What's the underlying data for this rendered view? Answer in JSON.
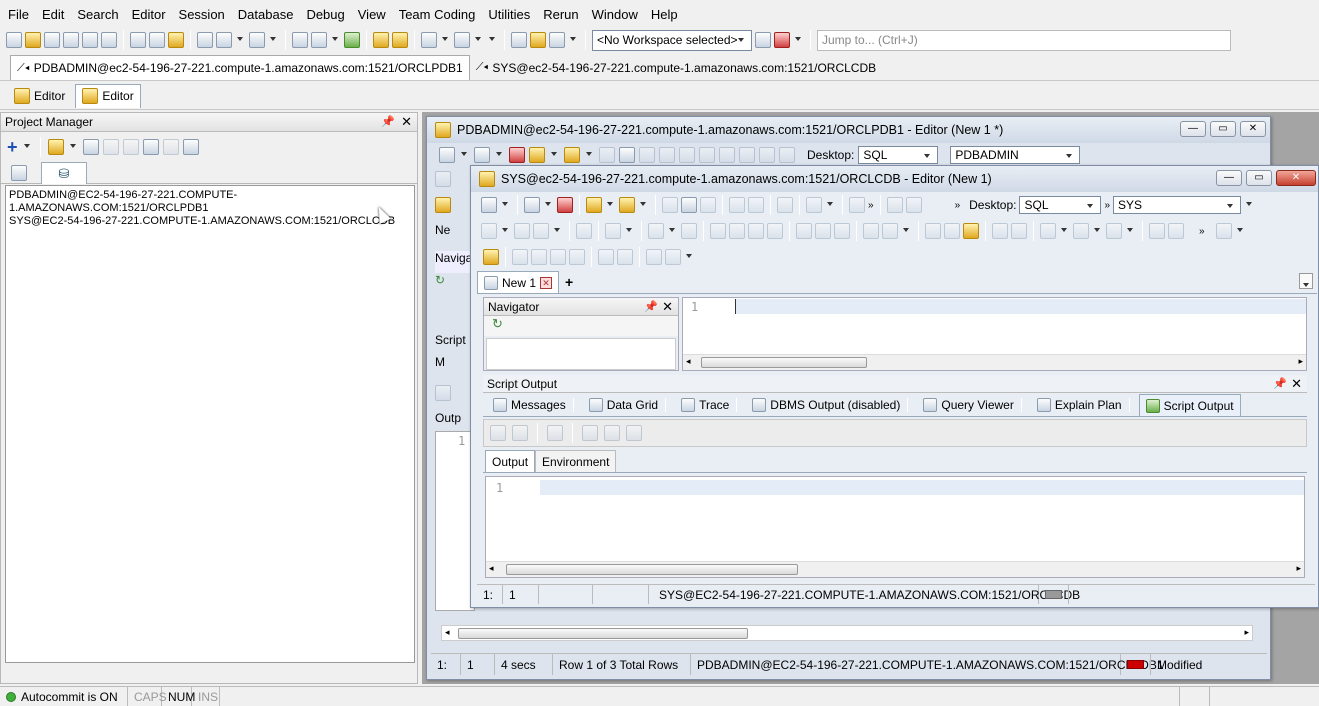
{
  "menu": [
    "File",
    "Edit",
    "Search",
    "Editor",
    "Session",
    "Database",
    "Debug",
    "View",
    "Team Coding",
    "Utilities",
    "Rerun",
    "Window",
    "Help"
  ],
  "workspace": {
    "selected": "<No Workspace selected>"
  },
  "jump": {
    "placeholder": "Jump to... (Ctrl+J)"
  },
  "connections": [
    {
      "label": "PDBADMIN@ec2-54-196-27-221.compute-1.amazonaws.com:1521/ORCLPDB1"
    },
    {
      "label": "SYS@ec2-54-196-27-221.compute-1.amazonaws.com:1521/ORCLCDB"
    }
  ],
  "editor_tabs": [
    "Editor",
    "Editor"
  ],
  "project_manager": {
    "title": "Project Manager",
    "items": [
      "PDBADMIN@EC2-54-196-27-221.COMPUTE-1.AMAZONAWS.COM:1521/ORCLPDB1",
      "SYS@EC2-54-196-27-221.COMPUTE-1.AMAZONAWS.COM:1521/ORCLCDB"
    ]
  },
  "back_window": {
    "title": "PDBADMIN@ec2-54-196-27-221.compute-1.amazonaws.com:1521/ORCLPDB1 - Editor (New 1 *)",
    "desktop_label": "Desktop:",
    "desktop_value": "SQL",
    "schema": "PDBADMIN",
    "tab_partial": "Ne",
    "nav_partial": "Naviga",
    "script_partial": "Script",
    "msg_partial": "M",
    "output_partial": "Outp",
    "line_no": "1",
    "status": {
      "pos": "1:",
      "col": "1",
      "time": "4 secs",
      "rows": "Row 1 of 3 Total Rows",
      "conn": "PDBADMIN@EC2-54-196-27-221.COMPUTE-1.AMAZONAWS.COM:1521/ORCLPDB1",
      "state": "Modified"
    }
  },
  "front_window": {
    "title": "SYS@ec2-54-196-27-221.compute-1.amazonaws.com:1521/ORCLCDB - Editor (New 1)",
    "desktop_label": "Desktop:",
    "desktop_value": "SQL",
    "schema": "SYS",
    "doc_tab": "New 1",
    "add_tab": "+",
    "navigator_title": "Navigator",
    "line_no": "1",
    "script_output_title": "Script Output",
    "output_tabs": [
      "Messages",
      "Data Grid",
      "Trace",
      "DBMS Output (disabled)",
      "Query Viewer",
      "Explain Plan",
      "Script Output"
    ],
    "inner_tabs": [
      "Output",
      "Environment"
    ],
    "output_line_no": "1",
    "status": {
      "pos": "1:",
      "col": "1",
      "conn": "SYS@EC2-54-196-27-221.COMPUTE-1.AMAZONAWS.COM:1521/ORCLCDB"
    }
  },
  "statusbar": {
    "autocommit": "Autocommit is ON",
    "caps": "CAPS",
    "num": "NUM",
    "ins": "INS"
  }
}
